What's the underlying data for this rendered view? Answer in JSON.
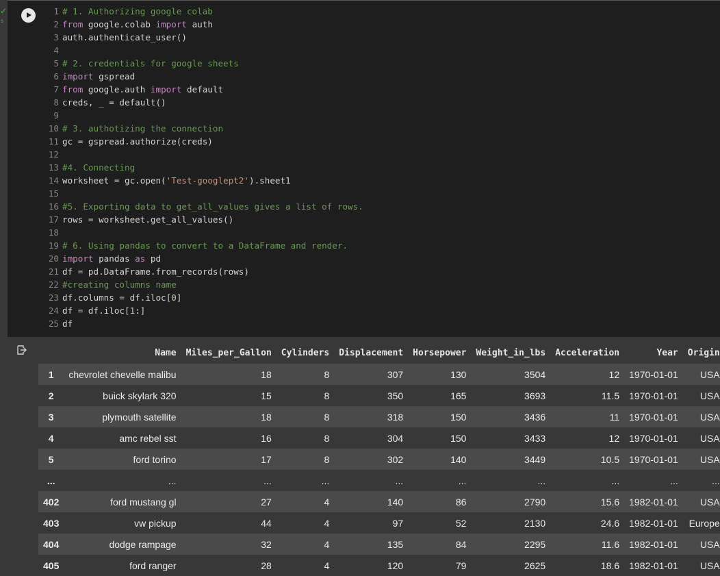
{
  "cell": {
    "status_check": "✓",
    "status_label": "s",
    "run_button_label": "Run cell",
    "code_lines": [
      [
        [
          "cm",
          "# 1. Authorizing google colab"
        ]
      ],
      [
        [
          "kw",
          "from"
        ],
        [
          "tx",
          " google.colab "
        ],
        [
          "kw",
          "import"
        ],
        [
          "tx",
          " auth"
        ]
      ],
      [
        [
          "tx",
          "auth.authenticate_user()"
        ]
      ],
      [
        [
          "tx",
          ""
        ]
      ],
      [
        [
          "cm",
          "# 2. credentials for google sheets"
        ]
      ],
      [
        [
          "kw",
          "import"
        ],
        [
          "tx",
          " gspread"
        ]
      ],
      [
        [
          "kw",
          "from"
        ],
        [
          "tx",
          " google.auth "
        ],
        [
          "kw",
          "import"
        ],
        [
          "tx",
          " default"
        ]
      ],
      [
        [
          "tx",
          "creds, _ = default()"
        ]
      ],
      [
        [
          "tx",
          ""
        ]
      ],
      [
        [
          "cm",
          "# 3. authotizing the connection"
        ]
      ],
      [
        [
          "tx",
          "gc = gspread.authorize(creds)"
        ]
      ],
      [
        [
          "tx",
          ""
        ]
      ],
      [
        [
          "cm",
          "#4. Connecting"
        ]
      ],
      [
        [
          "tx",
          "worksheet = gc.open("
        ],
        [
          "st",
          "'Test-googlept2'"
        ],
        [
          "tx",
          ").sheet1"
        ]
      ],
      [
        [
          "tx",
          ""
        ]
      ],
      [
        [
          "cm",
          "#5. Exporting data to get_all_values gives a list of rows."
        ]
      ],
      [
        [
          "tx",
          "rows = worksheet.get_all_values()"
        ]
      ],
      [
        [
          "tx",
          ""
        ]
      ],
      [
        [
          "cm",
          "# 6. Using pandas to convert to a DataFrame and render."
        ]
      ],
      [
        [
          "kw",
          "import"
        ],
        [
          "tx",
          " pandas "
        ],
        [
          "kw",
          "as"
        ],
        [
          "tx",
          " pd"
        ]
      ],
      [
        [
          "tx",
          "df = pd.DataFrame.from_records(rows)"
        ]
      ],
      [
        [
          "cm",
          "#creating columns name"
        ]
      ],
      [
        [
          "tx",
          "df.columns = df.iloc["
        ],
        [
          "nm",
          "0"
        ],
        [
          "tx",
          "]"
        ]
      ],
      [
        [
          "tx",
          "df = df.iloc["
        ],
        [
          "nm",
          "1"
        ],
        [
          "tx",
          ":]"
        ]
      ],
      [
        [
          "tx",
          "df"
        ]
      ]
    ]
  },
  "output": {
    "icon": "output-redirect-icon",
    "columns": [
      "",
      "Name",
      "Miles_per_Gallon",
      "Cylinders",
      "Displacement",
      "Horsepower",
      "Weight_in_lbs",
      "Acceleration",
      "Year",
      "Origin"
    ],
    "rows": [
      [
        "1",
        "chevrolet chevelle malibu",
        "18",
        "8",
        "307",
        "130",
        "3504",
        "12",
        "1970-01-01",
        "USA"
      ],
      [
        "2",
        "buick skylark 320",
        "15",
        "8",
        "350",
        "165",
        "3693",
        "11.5",
        "1970-01-01",
        "USA"
      ],
      [
        "3",
        "plymouth satellite",
        "18",
        "8",
        "318",
        "150",
        "3436",
        "11",
        "1970-01-01",
        "USA"
      ],
      [
        "4",
        "amc rebel sst",
        "16",
        "8",
        "304",
        "150",
        "3433",
        "12",
        "1970-01-01",
        "USA"
      ],
      [
        "5",
        "ford torino",
        "17",
        "8",
        "302",
        "140",
        "3449",
        "10.5",
        "1970-01-01",
        "USA"
      ],
      [
        "...",
        "...",
        "...",
        "...",
        "...",
        "...",
        "...",
        "...",
        "...",
        "..."
      ],
      [
        "402",
        "ford mustang gl",
        "27",
        "4",
        "140",
        "86",
        "2790",
        "15.6",
        "1982-01-01",
        "USA"
      ],
      [
        "403",
        "vw pickup",
        "44",
        "4",
        "97",
        "52",
        "2130",
        "24.6",
        "1982-01-01",
        "Europe"
      ],
      [
        "404",
        "dodge rampage",
        "32",
        "4",
        "135",
        "84",
        "2295",
        "11.6",
        "1982-01-01",
        "USA"
      ],
      [
        "405",
        "ford ranger",
        "28",
        "4",
        "120",
        "79",
        "2625",
        "18.6",
        "1982-01-01",
        "USA"
      ]
    ]
  }
}
